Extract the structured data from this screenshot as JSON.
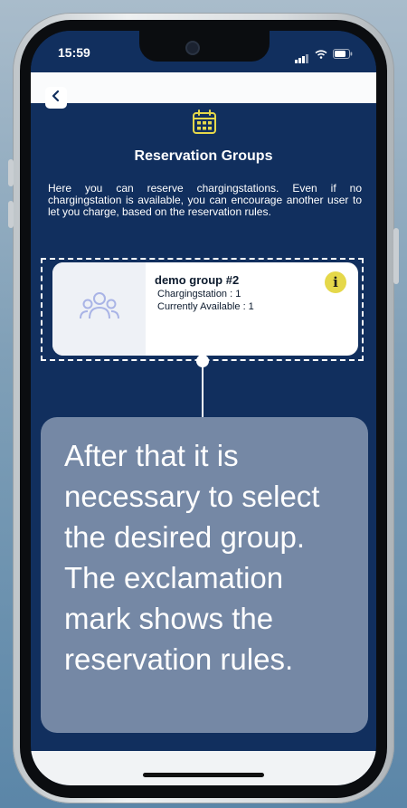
{
  "status_bar": {
    "time": "15:59"
  },
  "header": {
    "title": "Reservation Groups"
  },
  "intro_text": "Here you can reserve chargingstations. Even if no chargingstation is available, you can encourage another user to let you charge, based on the reservation rules.",
  "group_card": {
    "name": "demo group #2",
    "chargingstation_line": "Chargingstation : 1",
    "available_line": "Currently Available : 1",
    "info_label": "i"
  },
  "callout": {
    "text": "After that it is necessary to select the desired group. The exclamation mark shows the reservation rules."
  },
  "colors": {
    "screen_background": "#112f5e",
    "info_badge": "#e5d84a",
    "calendar_icon": "#e5d84a",
    "callout_background": "#7588a5"
  },
  "icons": {
    "back": "chevron-left-icon",
    "calendar": "calendar-icon",
    "group": "users-group-icon",
    "info": "info-icon"
  }
}
